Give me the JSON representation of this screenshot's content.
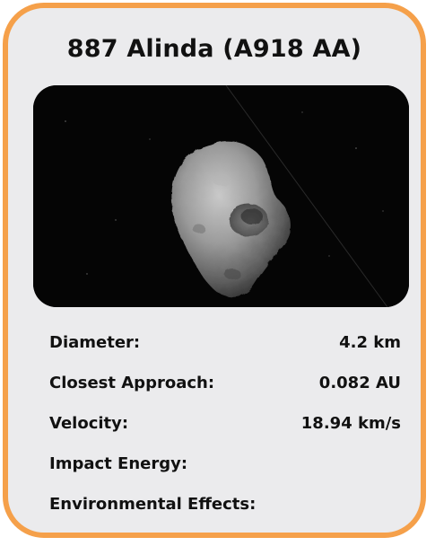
{
  "card": {
    "title": "887 Alinda (A918 AA)",
    "accent_color": "#f5a04a",
    "background_color": "#ebebed",
    "image": {
      "icon": "asteroid-image"
    },
    "stats": [
      {
        "label": "Diameter:",
        "value": "4.2 km"
      },
      {
        "label": "Closest Approach:",
        "value": "0.082 AU"
      },
      {
        "label": "Velocity:",
        "value": "18.94 km/s"
      },
      {
        "label": "Impact Energy:",
        "value": ""
      },
      {
        "label": "Environmental Effects:",
        "value": ""
      }
    ]
  }
}
